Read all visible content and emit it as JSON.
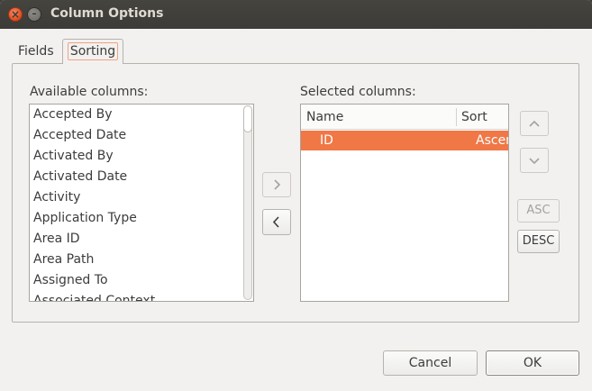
{
  "window": {
    "title": "Column Options"
  },
  "tabs": [
    {
      "label": "Fields"
    },
    {
      "label": "Sorting"
    }
  ],
  "available": {
    "label": "Available columns:",
    "items": [
      "Accepted By",
      "Accepted Date",
      "Activated By",
      "Activated Date",
      "Activity",
      "Application Type",
      "Area ID",
      "Area Path",
      "Assigned To",
      "Associated Context"
    ]
  },
  "selected": {
    "label": "Selected columns:",
    "headers": {
      "name": "Name",
      "sort": "Sort"
    },
    "rows": [
      {
        "name": "ID",
        "sort": "Ascending"
      }
    ]
  },
  "sort_buttons": {
    "asc": "ASC",
    "desc": "DESC"
  },
  "footer": {
    "cancel": "Cancel",
    "ok": "OK"
  },
  "colors": {
    "selection": "#f07746",
    "titlebar": "#3c3b37",
    "close": "#e25424"
  }
}
